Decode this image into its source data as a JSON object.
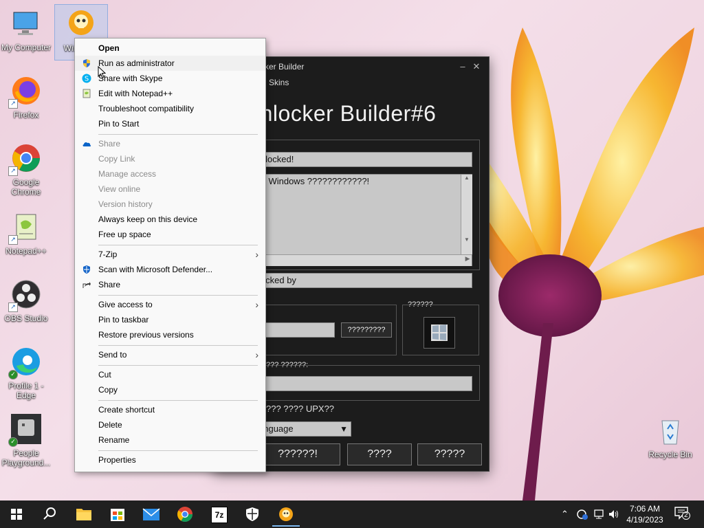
{
  "desktop": {
    "icons": [
      {
        "label": "My Computer"
      },
      {
        "label": "Win Build"
      },
      {
        "label": "Firefox"
      },
      {
        "label": "Google Chrome"
      },
      {
        "label": "Notepad++"
      },
      {
        "label": "OBS Studio"
      },
      {
        "label": "Profile 1 - Edge"
      },
      {
        "label": "People Playground..."
      },
      {
        "label": "Recycle Bin"
      }
    ]
  },
  "builder": {
    "title": "ker Builder",
    "menu_skins": "Skins",
    "heading": "inlocker Builder#6",
    "field_locked": "s locked!",
    "textarea_text": "?! Windows ????????????!",
    "field_locked_by": "locked by",
    "label_group": "??????",
    "button_browse": "?????????",
    "label_path": "??? ??????:",
    "label_upx": "??? ???? UPX??",
    "select_language": "anguage",
    "button_1": "??????!",
    "button_2": "????",
    "button_3": "?????"
  },
  "context_menu": {
    "open": "Open",
    "run_admin": "Run as administrator",
    "share_skype": "Share with Skype",
    "edit_notepad": "Edit with Notepad++",
    "troubleshoot": "Troubleshoot compatibility",
    "pin_start": "Pin to Start",
    "share_od": "Share",
    "copy_link": "Copy Link",
    "manage_access": "Manage access",
    "view_online": "View online",
    "version_history": "Version history",
    "always_keep": "Always keep on this device",
    "free_space": "Free up space",
    "seven_zip": "7-Zip",
    "scan_defender": "Scan with Microsoft Defender...",
    "share": "Share",
    "give_access": "Give access to",
    "pin_taskbar": "Pin to taskbar",
    "restore_versions": "Restore previous versions",
    "send_to": "Send to",
    "cut": "Cut",
    "copy": "Copy",
    "create_shortcut": "Create shortcut",
    "delete": "Delete",
    "rename": "Rename",
    "properties": "Properties"
  },
  "taskbar": {
    "time": "7:06 AM",
    "date": "4/19/2023",
    "notification_count": "2",
    "zip_label": "7z"
  }
}
